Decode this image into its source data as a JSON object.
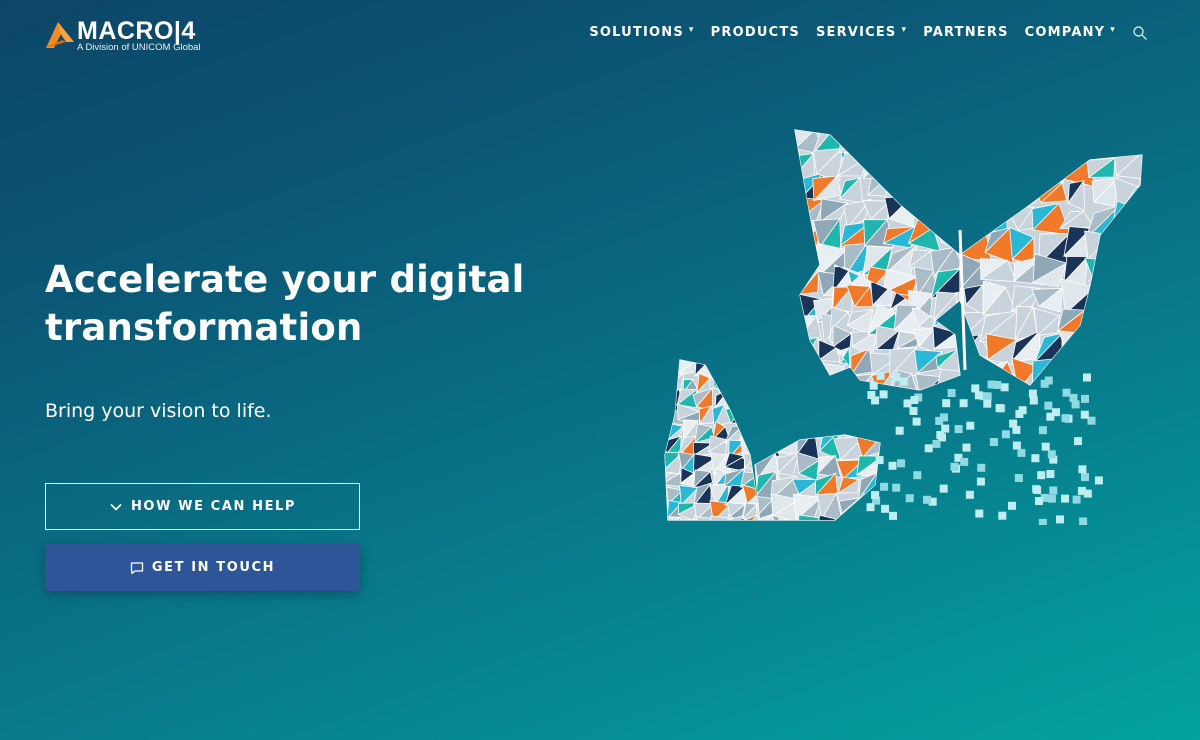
{
  "brand": {
    "name": "MACRO|4",
    "tagline": "A Division of UNICOM Global",
    "accent": "#f08a24"
  },
  "nav": {
    "items": [
      {
        "label": "SOLUTIONS",
        "has_dropdown": true
      },
      {
        "label": "PRODUCTS",
        "has_dropdown": false
      },
      {
        "label": "SERVICES",
        "has_dropdown": true
      },
      {
        "label": "PARTNERS",
        "has_dropdown": false
      },
      {
        "label": "COMPANY",
        "has_dropdown": true
      }
    ],
    "search_icon": "search-icon"
  },
  "hero": {
    "title": "Accelerate your digital transformation",
    "subtitle": "Bring your vision to life.",
    "buttons": {
      "help": {
        "label": "HOW WE CAN HELP",
        "icon": "chevron-down-icon"
      },
      "contact": {
        "label": "GET IN TOUCH",
        "icon": "chat-icon"
      }
    }
  },
  "colors": {
    "background_start": "#0d4566",
    "background_end": "#03a39e",
    "primary_button": "#2d5597",
    "triangle_orange": "#f07a2a",
    "triangle_teal": "#1fb6ad",
    "triangle_cyan": "#2bb7d6",
    "triangle_navy": "#1a3358",
    "triangle_light": "#c8d3dc"
  },
  "illustration": {
    "name": "polygon-butterflies-illustration"
  }
}
